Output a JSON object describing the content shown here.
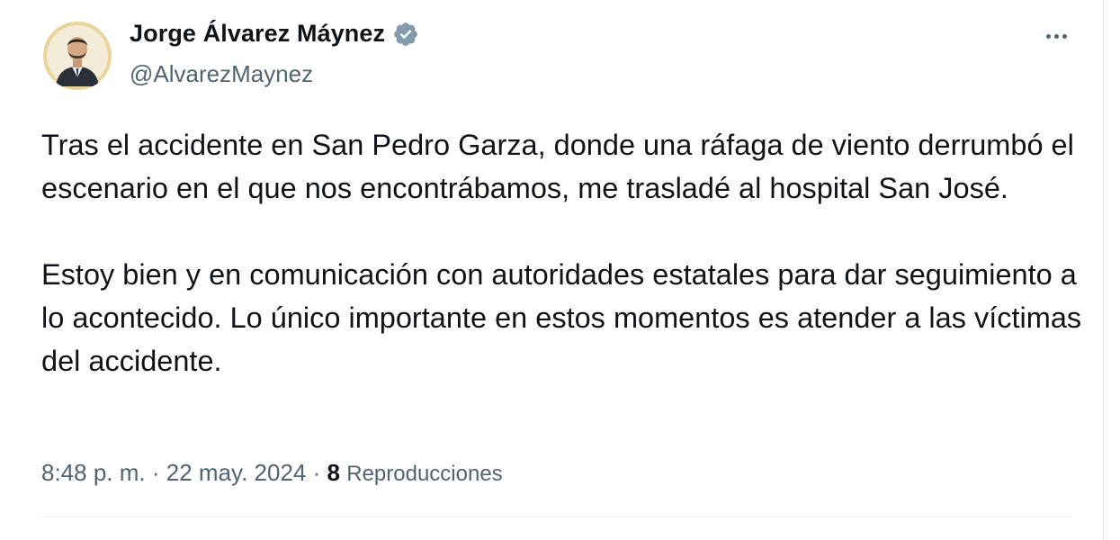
{
  "author": {
    "name": "Jorge Álvarez Máynez",
    "handle": "@AlvarezMaynez",
    "verified": true,
    "avatar_icon": "profile-photo"
  },
  "tweet": {
    "paragraphs": [
      "Tras el accidente en San Pedro Garza, donde una ráfaga de viento derrumbó el escenario en el que nos encontrábamos, me trasladé al hospital San José.",
      "Estoy bien y en comunicación con autoridades estatales para dar seguimiento a lo acontecido. Lo único importante en estos momentos es atender a las víctimas del accidente."
    ]
  },
  "meta": {
    "time": "8:48 p. m.",
    "separator": "·",
    "date": "22 may. 2024",
    "views_count": "8",
    "views_label": "Reproducciones"
  },
  "actions": {
    "more_icon": "more-options-icon"
  },
  "colors": {
    "text": "#0f1419",
    "secondary": "#536471",
    "verified_badge": "#829aab",
    "avatar_ring": "#e9d49c"
  }
}
